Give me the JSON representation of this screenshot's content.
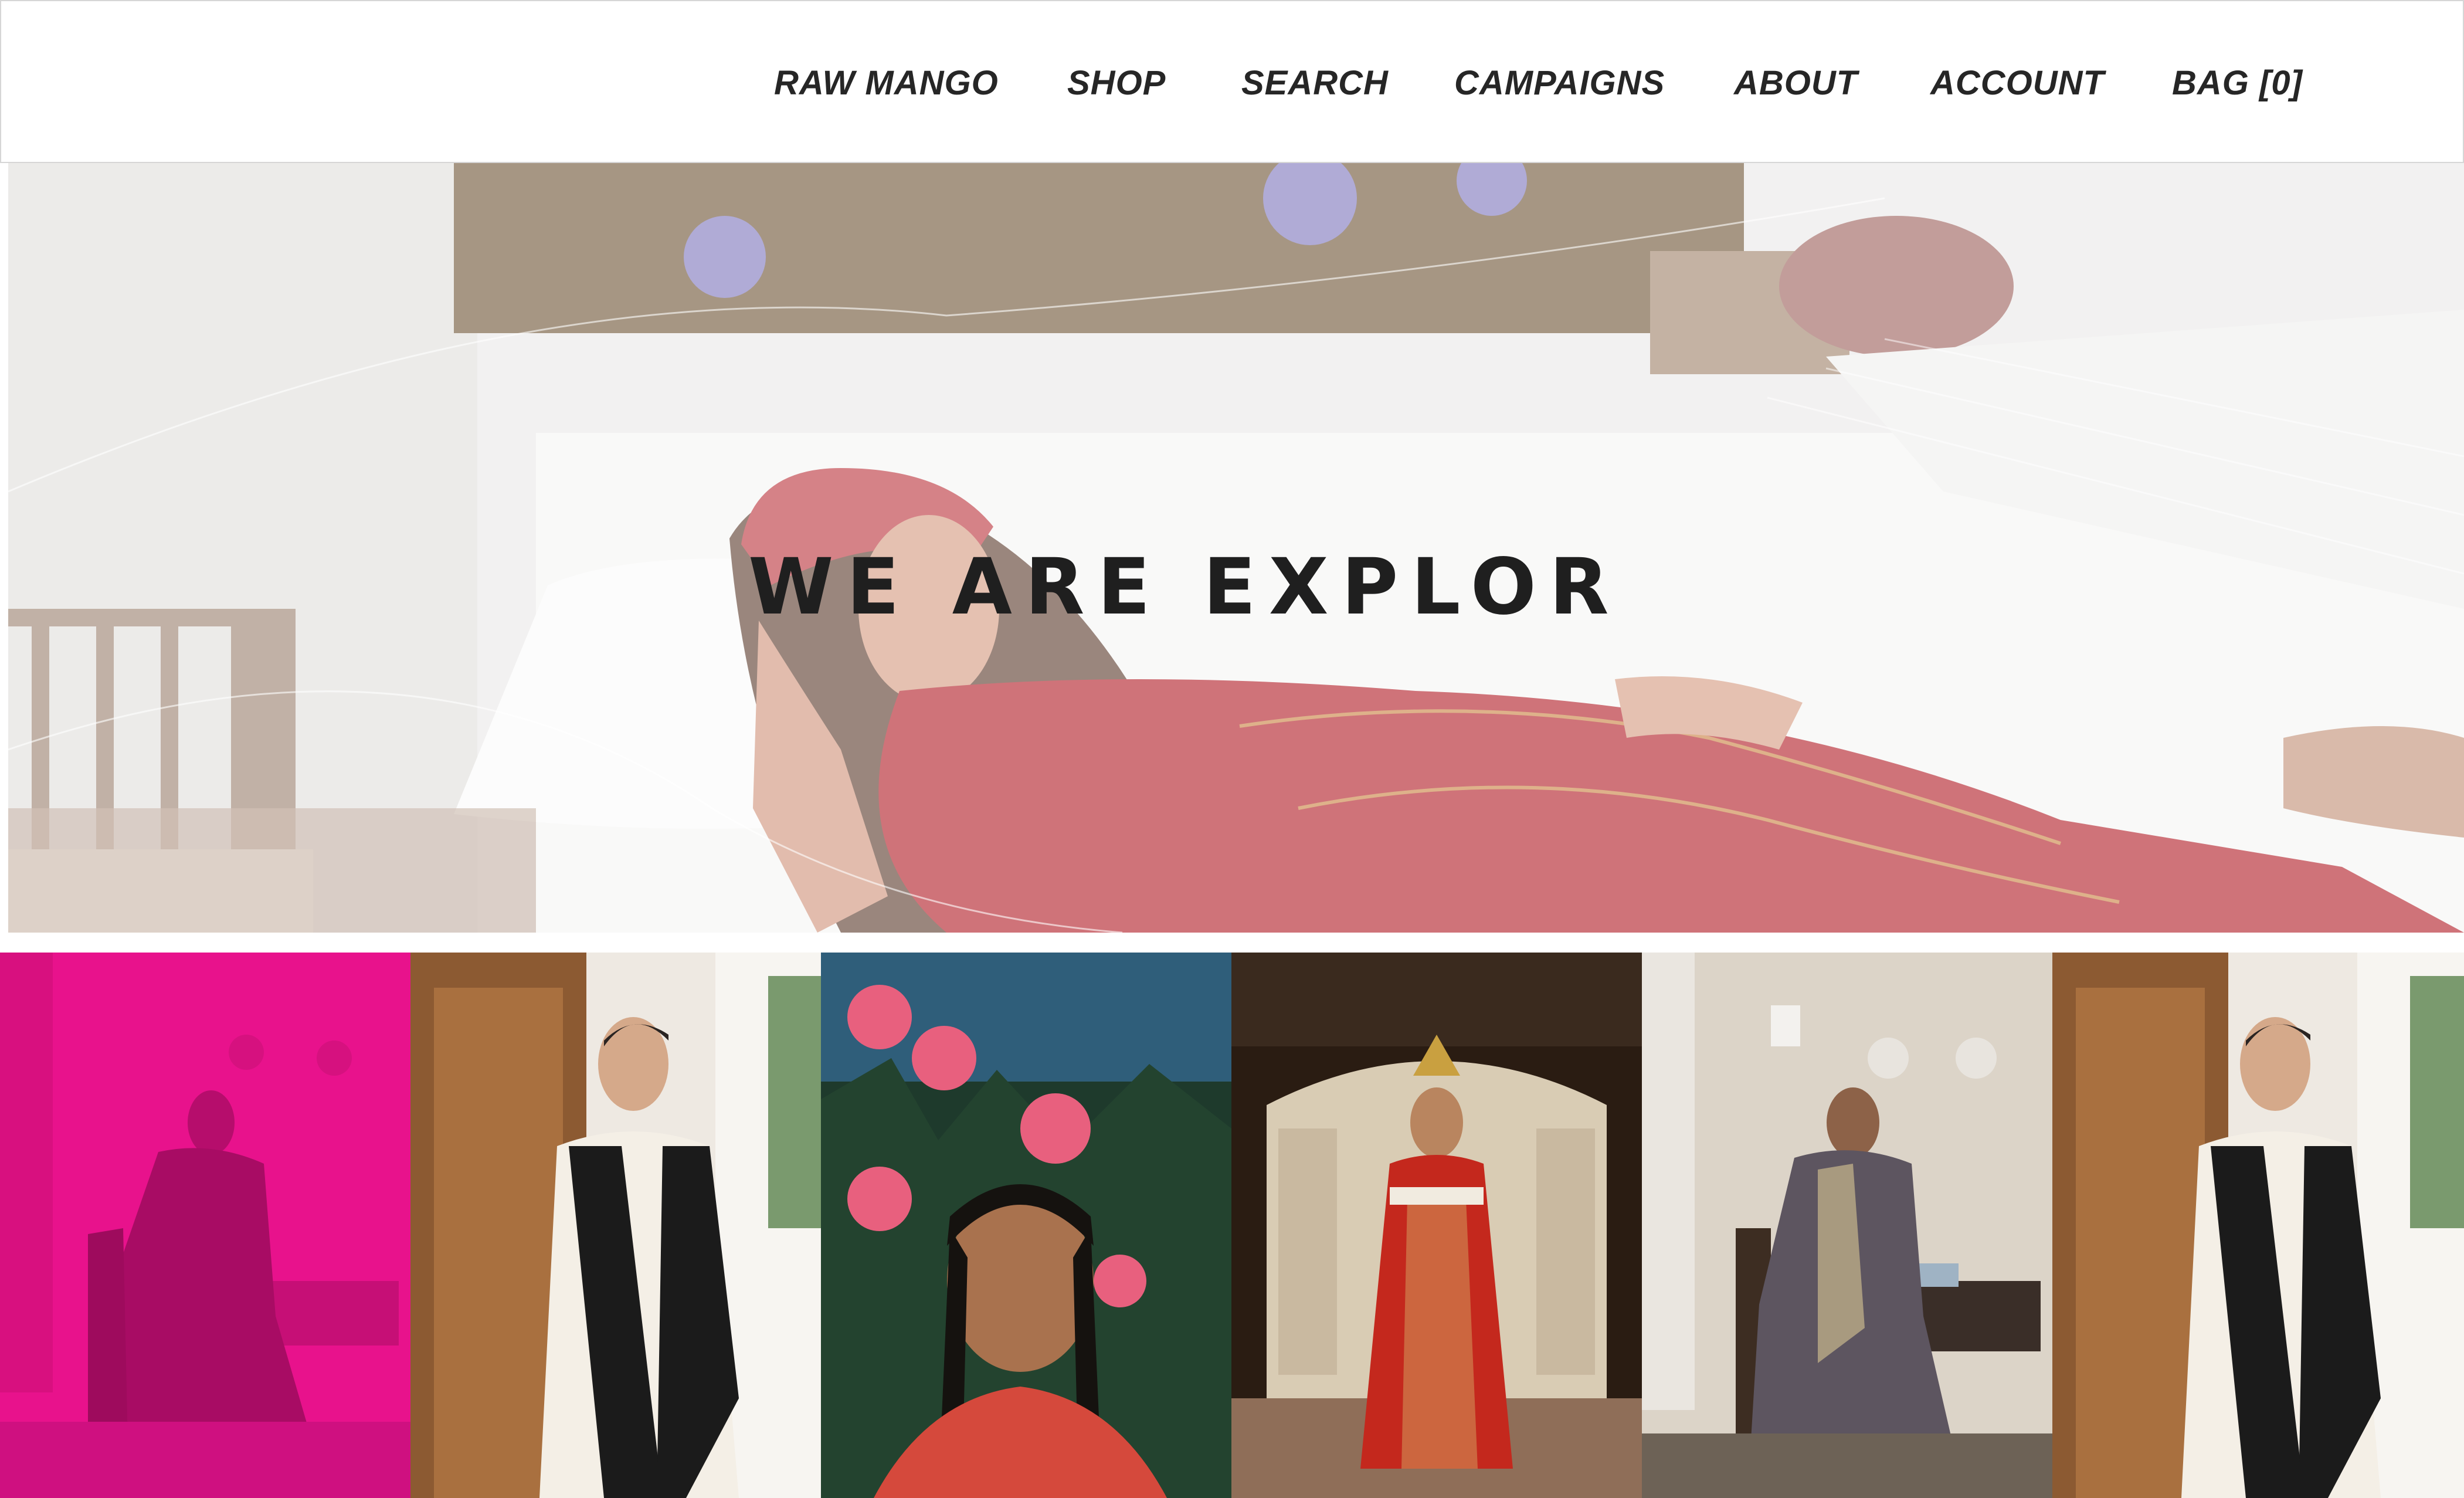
{
  "header": {
    "nav": [
      {
        "label": "RAW MANGO"
      },
      {
        "label": "SHOP"
      },
      {
        "label": "SEARCH"
      },
      {
        "label": "CAMPAIGNS"
      },
      {
        "label": "ABOUT"
      },
      {
        "label": "ACCOUNT"
      },
      {
        "label": "BAG [0]"
      }
    ]
  },
  "hero": {
    "title": "WE ARE EXPLOR"
  },
  "colors": {
    "nav_text": "#262626",
    "hero_title": "#1f1f1f",
    "accent_pink": "#e8128c",
    "garment_red": "#b8323a"
  },
  "gallery": {
    "tiles": [
      {
        "photo": "woman-in-grey-sari-seated-pink-overlay"
      },
      {
        "photo": "woman-in-ivory-black-sari-by-wardrobe"
      },
      {
        "photo": "portrait-with-pink-flowers"
      },
      {
        "photo": "woman-in-red-lehenga-painted-hall"
      },
      {
        "photo": "woman-in-grey-sari-seated"
      },
      {
        "photo": "woman-in-ivory-black-sari-by-wardrobe"
      }
    ]
  }
}
